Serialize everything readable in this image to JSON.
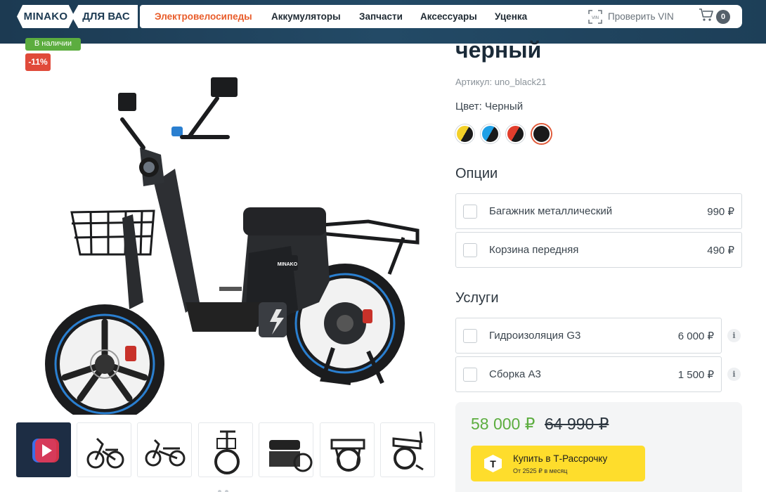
{
  "header": {
    "logo": "MINAKO",
    "for_you": "ДЛЯ ВАС",
    "nav": [
      {
        "label": "Электровелосипеды",
        "active": true
      },
      {
        "label": "Аккумуляторы",
        "active": false
      },
      {
        "label": "Запчасти",
        "active": false
      },
      {
        "label": "Аксессуары",
        "active": false
      },
      {
        "label": "Уценка",
        "active": false
      }
    ],
    "vin_label": "Проверить VIN",
    "vin_icon_text": "VIN",
    "cart_icon": "cart-icon",
    "cart_count": "0"
  },
  "gallery": {
    "badge_stock": "В наличии",
    "badge_discount": "-11%",
    "thumbnails_count": 7,
    "first_thumb_icon": "play-video-icon"
  },
  "product": {
    "title": "черный",
    "sku": "Артикул: uno_black21",
    "color_label": "Цвет: Черный",
    "swatches": [
      {
        "name": "yellow-black",
        "colors": [
          "#f3d028",
          "#1a1a1a"
        ],
        "selected": false
      },
      {
        "name": "blue-black",
        "colors": [
          "#1fa0e6",
          "#1a1a1a"
        ],
        "selected": false
      },
      {
        "name": "red-black",
        "colors": [
          "#e23d2c",
          "#1a1a1a"
        ],
        "selected": false
      },
      {
        "name": "black",
        "colors": [
          "#1a1a1a",
          "#1a1a1a"
        ],
        "selected": true
      }
    ],
    "options_title": "Опции",
    "options": [
      {
        "label": "Багажник металлический",
        "price": "990 ₽"
      },
      {
        "label": "Корзина передняя",
        "price": "490 ₽"
      }
    ],
    "services_title": "Услуги",
    "services": [
      {
        "label": "Гидроизоляция G3",
        "price": "6 000 ₽"
      },
      {
        "label": "Сборка А3",
        "price": "1 500 ₽"
      }
    ],
    "info_icon": "i",
    "price": "58 000 ₽",
    "old_price": "64 990 ₽",
    "installment": {
      "logo": "Т",
      "title": "Купить в Т-Рассрочку",
      "subtitle": "От 2525 ₽ в месяц"
    }
  },
  "colors": {
    "accent": "#e85c2a",
    "header_bg": "#1c3a52",
    "price_green": "#5cad3f",
    "discount_red": "#e04a3a",
    "tbank_yellow": "#fedd2c"
  }
}
